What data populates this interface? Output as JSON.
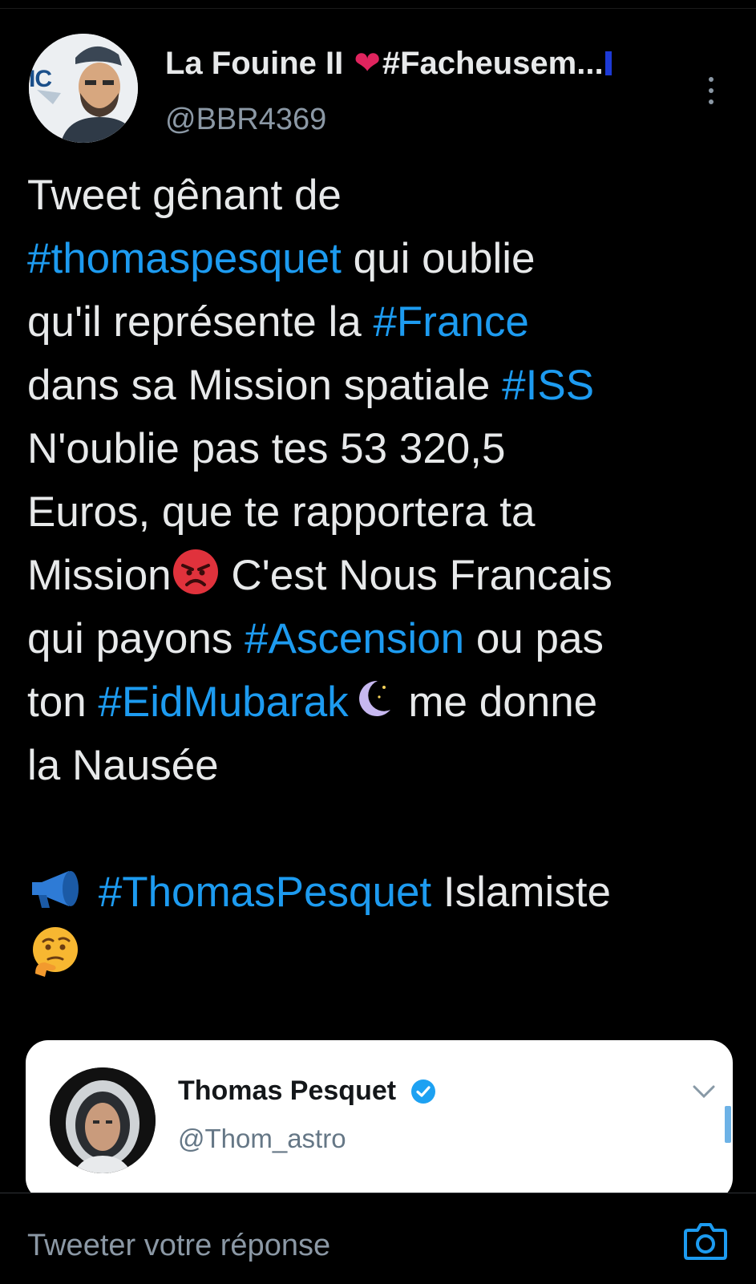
{
  "tweet": {
    "author_name": "La Fouine II",
    "author_name_suffix": "#Facheusem...",
    "author_handle": "@BBR4369",
    "avatar_badge": "IC",
    "lines": [
      [
        {
          "t": "Tweet gênant de"
        }
      ],
      [
        {
          "t": "#thomaspesquet",
          "tag": true
        },
        {
          "t": " qui oublie"
        }
      ],
      [
        {
          "t": "qu'il représente la "
        },
        {
          "t": "#France",
          "tag": true
        }
      ],
      [
        {
          "t": "dans sa Mission spatiale "
        },
        {
          "t": "#ISS",
          "tag": true
        }
      ],
      [
        {
          "t": "N'oublie pas tes 53 320,5"
        }
      ],
      [
        {
          "t": "Euros, que te rapportera ta"
        }
      ],
      [
        {
          "t": "Mission"
        },
        {
          "emoji": "angry-face-emoji"
        },
        {
          "t": " C'est Nous Francais"
        }
      ],
      [
        {
          "t": "qui payons "
        },
        {
          "t": "#Ascension",
          "tag": true
        },
        {
          "t": " ou pas"
        }
      ],
      [
        {
          "t": "ton "
        },
        {
          "t": "#EidMubarak",
          "tag": true
        },
        {
          "emoji": "crescent-moon-emoji"
        },
        {
          "t": "  me donne"
        }
      ],
      [
        {
          "t": "la Nausée"
        }
      ],
      [
        {
          "t": ""
        }
      ],
      [
        {
          "emoji": "megaphone-emoji"
        },
        {
          "t": " "
        },
        {
          "t": "#ThomasPesquet",
          "tag": true
        },
        {
          "t": " Islamiste"
        }
      ],
      [
        {
          "emoji": "thinking-face-emoji"
        }
      ]
    ]
  },
  "quoted": {
    "name": "Thomas Pesquet",
    "handle": "@Thom_astro"
  },
  "reply": {
    "placeholder": "Tweeter votre réponse"
  },
  "colors": {
    "background": "#000000",
    "text": "#e7e9ea",
    "hashtag": "#1d9bf0",
    "muted": "#8b98a5",
    "heart": "#e0245e"
  }
}
